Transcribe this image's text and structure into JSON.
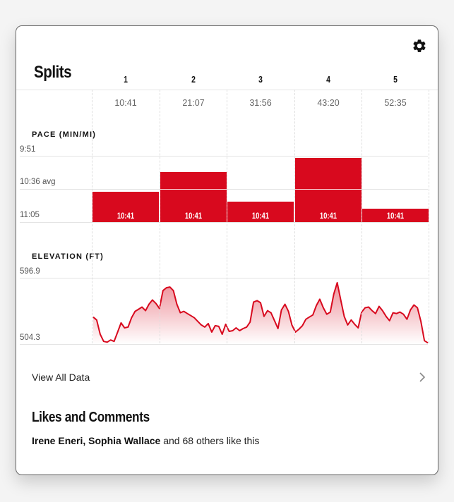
{
  "splits": {
    "title": "Splits",
    "columns": [
      {
        "num": "1",
        "time": "10:41"
      },
      {
        "num": "2",
        "time": "21:07"
      },
      {
        "num": "3",
        "time": "31:56"
      },
      {
        "num": "4",
        "time": "43:20"
      },
      {
        "num": "5",
        "time": "52:35"
      }
    ]
  },
  "pace": {
    "label": "PACE (MIN/MI)",
    "axis_top": "9:51",
    "axis_avg": "10:36 avg",
    "axis_bottom": "11:05",
    "bar_color": "#d8091e",
    "bars": [
      {
        "label": "10:41",
        "level": 0.46
      },
      {
        "label": "10:41",
        "level": 0.76
      },
      {
        "label": "10:41",
        "level": 0.31
      },
      {
        "label": "10:41",
        "level": 0.97
      },
      {
        "label": "10:41",
        "level": 0.2
      }
    ]
  },
  "elevation": {
    "label": "ELEVATION (FT)",
    "axis_top": "596.9",
    "axis_bottom": "504.3",
    "line_color": "#d8091e",
    "profile": [
      542,
      538,
      518,
      508,
      507,
      510,
      508,
      521,
      534,
      527,
      528,
      541,
      550,
      553,
      556,
      551,
      560,
      566,
      561,
      554,
      579,
      583,
      584,
      579,
      560,
      548,
      550,
      547,
      544,
      541,
      536,
      531,
      528,
      533,
      521,
      530,
      529,
      518,
      532,
      522,
      523,
      527,
      523,
      526,
      528,
      535,
      563,
      565,
      562,
      543,
      551,
      548,
      537,
      526,
      552,
      560,
      550,
      531,
      521,
      525,
      530,
      539,
      542,
      545,
      558,
      567,
      555,
      546,
      549,
      574,
      590,
      566,
      543,
      531,
      538,
      532,
      527,
      549,
      555,
      556,
      551,
      547,
      557,
      551,
      543,
      537,
      548,
      547,
      549,
      546,
      539,
      552,
      559,
      555,
      536,
      509,
      506
    ]
  },
  "view_all": {
    "label": "View All Data",
    "icon": "chevron-right-icon"
  },
  "likes": {
    "title": "Likes and Comments",
    "name1": "Irene Eneri",
    "name2": "Sophia Wallace",
    "rest": "and 68 others like this"
  },
  "header": {
    "settings_icon": "gear-icon"
  }
}
